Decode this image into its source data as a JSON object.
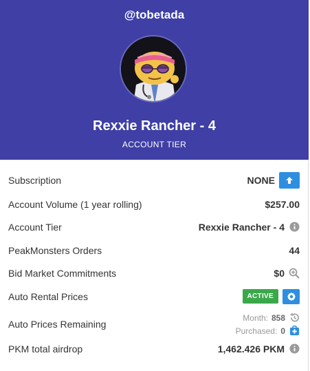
{
  "header": {
    "username": "@tobetada",
    "title": "Rexxie Rancher - 4",
    "subtitle": "ACCOUNT TIER"
  },
  "rows": {
    "subscription": {
      "label": "Subscription",
      "value": "NONE"
    },
    "volume": {
      "label": "Account Volume (1 year rolling)",
      "value": "$257.00"
    },
    "tier": {
      "label": "Account Tier",
      "value": "Rexxie Rancher - 4"
    },
    "orders": {
      "label": "PeakMonsters Orders",
      "value": "44"
    },
    "bid": {
      "label": "Bid Market Commitments",
      "value": "$0"
    },
    "auto_rental": {
      "label": "Auto Rental Prices",
      "status": "ACTIVE"
    },
    "auto_remaining": {
      "label": "Auto Prices Remaining",
      "month_label": "Month:",
      "month_value": "858",
      "purchased_label": "Purchased:",
      "purchased_value": "0"
    },
    "airdrop": {
      "label": "PKM total airdrop",
      "value": "1,462.426 PKM"
    }
  },
  "colors": {
    "header_bg": "#3f3fa6",
    "accent_blue": "#2e8fe0",
    "active_green": "#3aa84a"
  }
}
